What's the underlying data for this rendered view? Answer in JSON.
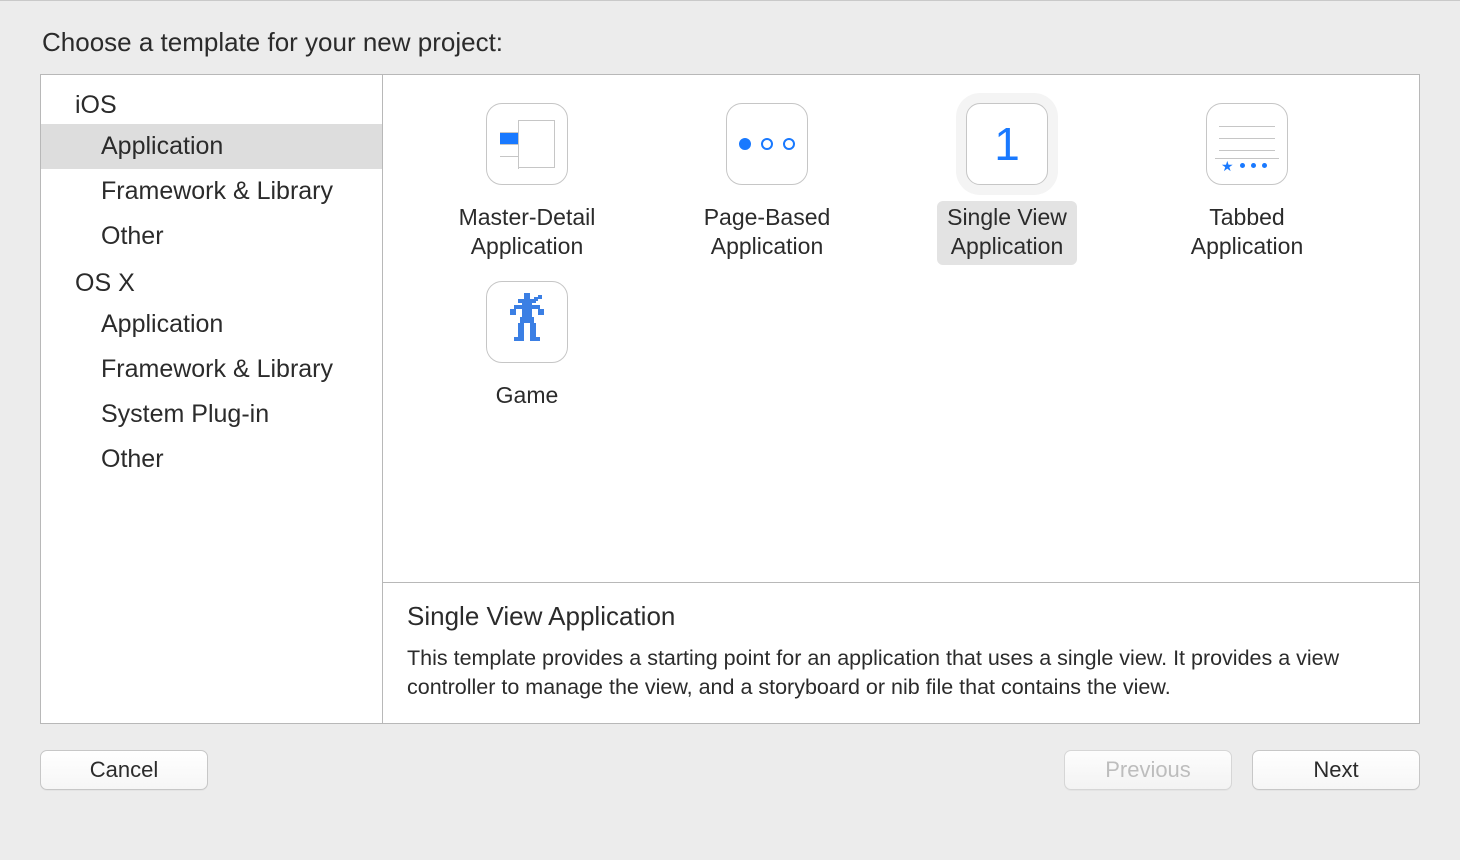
{
  "title": "Choose a template for your new project:",
  "sidebar": {
    "groups": [
      {
        "header": "iOS",
        "items": [
          {
            "label": "Application",
            "selected": true
          },
          {
            "label": "Framework & Library",
            "selected": false
          },
          {
            "label": "Other",
            "selected": false
          }
        ]
      },
      {
        "header": "OS X",
        "items": [
          {
            "label": "Application",
            "selected": false
          },
          {
            "label": "Framework & Library",
            "selected": false
          },
          {
            "label": "System Plug-in",
            "selected": false
          },
          {
            "label": "Other",
            "selected": false
          }
        ]
      }
    ]
  },
  "templates": [
    {
      "id": "master-detail",
      "label": "Master-Detail\nApplication",
      "selected": false,
      "icon": "master-detail-icon"
    },
    {
      "id": "page-based",
      "label": "Page-Based\nApplication",
      "selected": false,
      "icon": "page-based-icon"
    },
    {
      "id": "single-view",
      "label": "Single View\nApplication",
      "selected": true,
      "icon": "single-view-icon"
    },
    {
      "id": "tabbed",
      "label": "Tabbed\nApplication",
      "selected": false,
      "icon": "tabbed-icon"
    },
    {
      "id": "game",
      "label": "Game",
      "selected": false,
      "icon": "game-icon"
    }
  ],
  "description": {
    "title": "Single View Application",
    "body": "This template provides a starting point for an application that uses a single view. It provides a view controller to manage the view, and a storyboard or nib file that contains the view."
  },
  "buttons": {
    "cancel": {
      "label": "Cancel",
      "enabled": true
    },
    "previous": {
      "label": "Previous",
      "enabled": false
    },
    "next": {
      "label": "Next",
      "enabled": true
    }
  },
  "colors": {
    "accent": "#1979ff"
  }
}
